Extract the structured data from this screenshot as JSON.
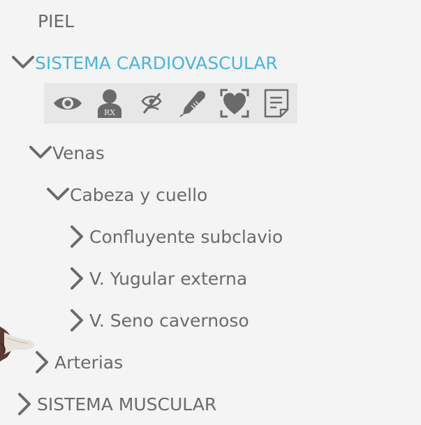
{
  "tree": {
    "piel": {
      "label": "PIEL"
    },
    "cardiovascular": {
      "label": "SISTEMA CARDIOVASCULAR",
      "expanded": true,
      "selected": true
    },
    "toolbar": {
      "tools": [
        {
          "icon": "eye-icon"
        },
        {
          "icon": "rx-person-icon"
        },
        {
          "icon": "hide-eye-icon"
        },
        {
          "icon": "pen-icon"
        },
        {
          "icon": "heart-focus-icon"
        },
        {
          "icon": "note-icon"
        }
      ]
    },
    "venas": {
      "label": "Venas",
      "expanded": true
    },
    "cabeza": {
      "label": "Cabeza y cuello",
      "expanded": true
    },
    "confluyente": {
      "label": "Confluyente subclavio",
      "expanded": false
    },
    "yugular": {
      "label": "V. Yugular externa",
      "expanded": false
    },
    "seno": {
      "label": "V. Seno cavernoso",
      "expanded": false
    },
    "arterias": {
      "label": "Arterias",
      "expanded": false
    },
    "muscular": {
      "label": "SISTEMA MUSCULAR",
      "expanded": false
    }
  },
  "colors": {
    "text": "#6a6a6a",
    "accent": "#4ab4dc",
    "toolbar_bg": "#e7e7e7",
    "background": "#f4f4f4"
  }
}
